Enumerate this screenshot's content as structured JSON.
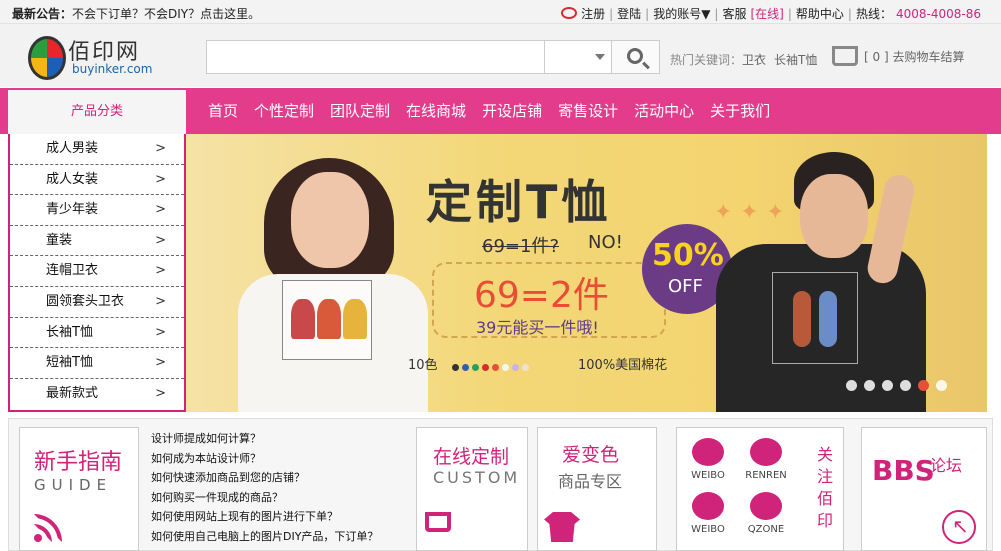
{
  "topbar": {
    "notice_label": "最新公告：",
    "notice_text": "不会下订单？不会DIY？点击这里。",
    "register": "注册",
    "login": "登陆",
    "account": "我的账号▼",
    "service": "客服",
    "online": "[在线]",
    "help": "帮助中心",
    "hotline_label": "热线：",
    "hotline": "4008-4008-86"
  },
  "header": {
    "logo_text": "佰印网",
    "logo_sub": "buyinker.com",
    "search_placeholder": "",
    "hot_label": "热门关键词：",
    "hot_keywords": [
      "卫衣",
      "长袖T恤"
    ],
    "cart_text": "[ 0 ] 去购物车结算"
  },
  "nav": {
    "category_label": "产品分类",
    "items": [
      "首页",
      "个性定制",
      "团队定制",
      "在线商城",
      "开设店铺",
      "寄售设计",
      "活动中心",
      "关于我们"
    ]
  },
  "categories": [
    "成人男装",
    "成人女装",
    "青少年装",
    "童装",
    "连帽卫衣",
    "圆领套头卫衣",
    "长袖T恤",
    "短袖T恤",
    "最新款式"
  ],
  "banner": {
    "title": "定制T恤",
    "old_price": "69=1件?",
    "no": "NO!",
    "price": "69=2件",
    "subtitle": "39元能买一件哦!",
    "badge_pct": "50%",
    "badge_off": "OFF",
    "colors_label": "10色",
    "cotton": "100%美国棉花",
    "swatches": [
      "#333333",
      "#2f5fb0",
      "#2ba05a",
      "#d92b2b",
      "#e84e36",
      "#f5f5f5",
      "#c9b3e6",
      "#f0e0d0"
    ],
    "slides_total": 6,
    "slide_active": 5
  },
  "guide": {
    "title": "新手指南",
    "subtitle": "GUIDE",
    "faq": [
      "设计师提成如何计算？",
      "如何成为本站设计师？",
      "如何快速添加商品到您的店铺？",
      "如何购买一件现成的商品？",
      "如何使用网站上现有的图片进行下单？",
      "如何使用自己电脑上的图片DIY产品，下订单？"
    ]
  },
  "custom": {
    "title": "在线定制",
    "subtitle": "CUSTOM"
  },
  "color": {
    "title": "爱变色",
    "subtitle": "商品专区"
  },
  "social": {
    "items": [
      "WEIBO",
      "RENREN",
      "WEIBO",
      "QZONE"
    ],
    "follow": "关注佰印"
  },
  "bbs": {
    "title": "BBS",
    "subtitle": "论坛"
  }
}
